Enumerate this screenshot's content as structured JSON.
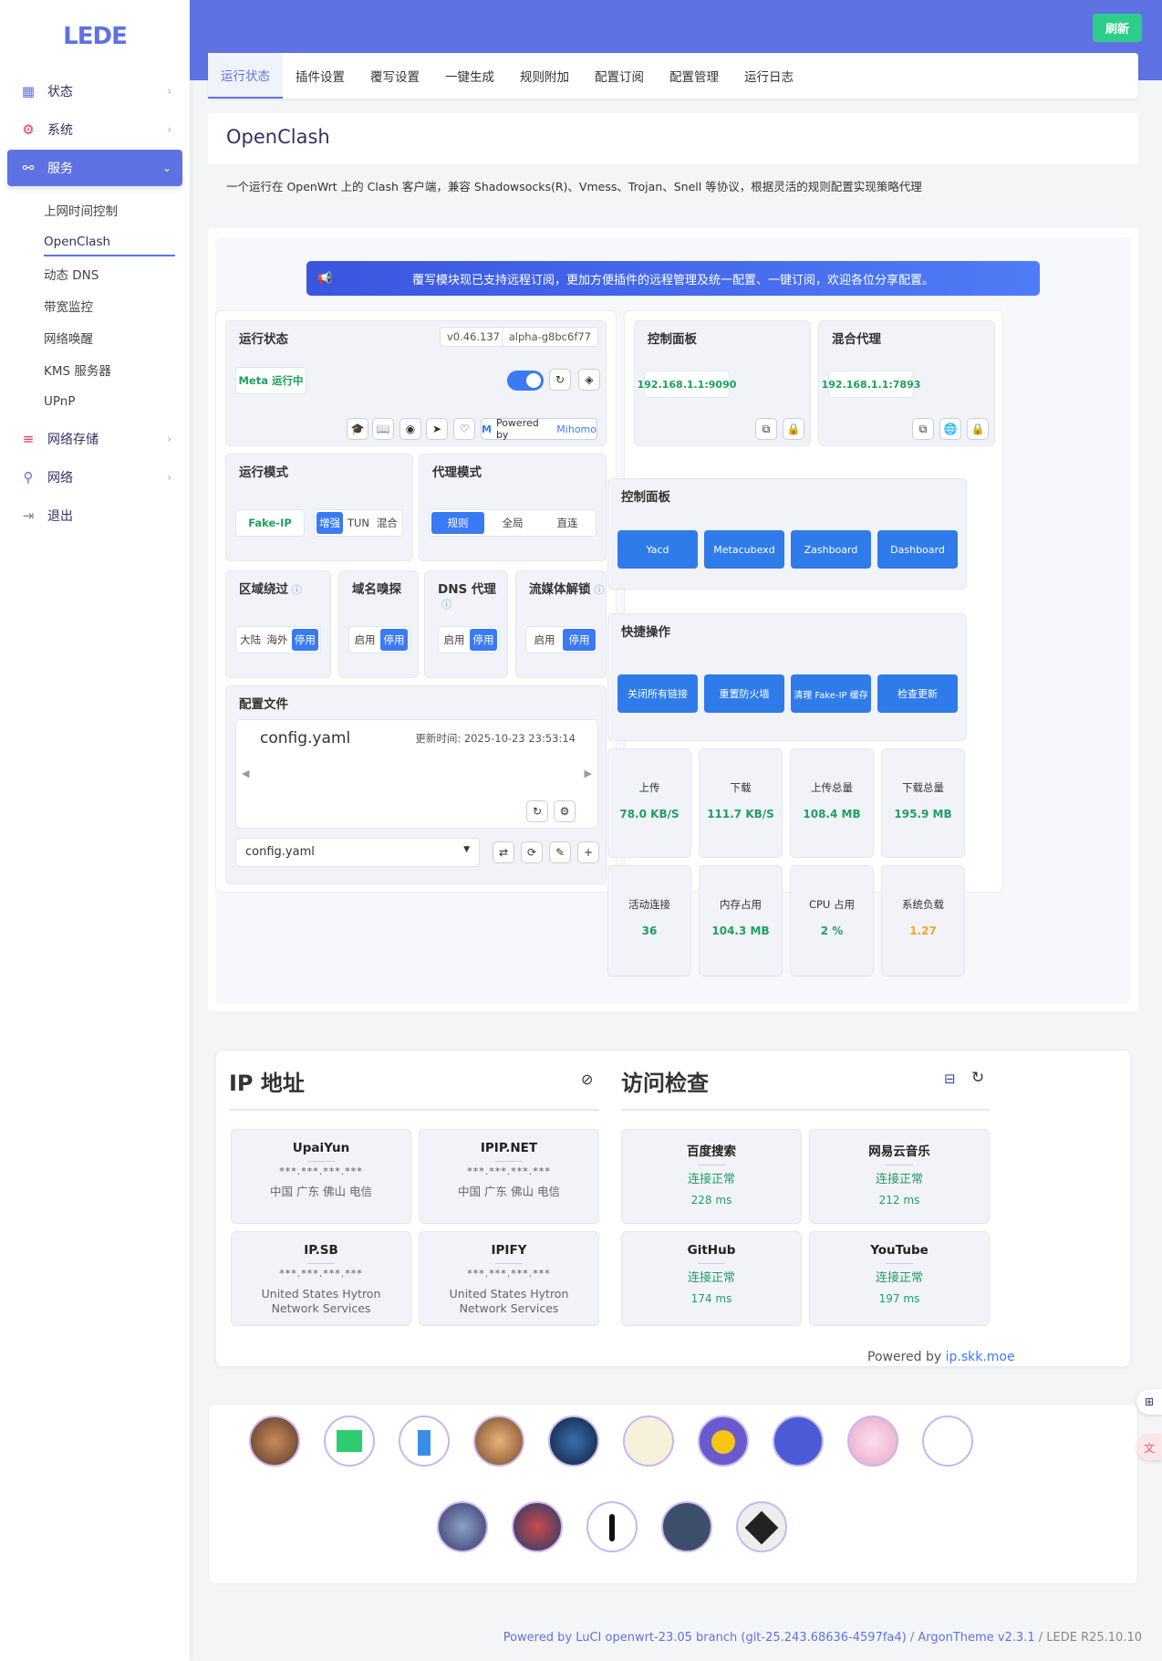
{
  "sidebar": {
    "logo": "LEDE",
    "items": [
      {
        "label": "状态",
        "icon": "dashboard-icon"
      },
      {
        "label": "系统",
        "icon": "gear-icon"
      },
      {
        "label": "服务",
        "icon": "services-icon"
      },
      {
        "label": "网络存储",
        "icon": "database-icon"
      },
      {
        "label": "网络",
        "icon": "network-icon"
      },
      {
        "label": "退出",
        "icon": "logout-icon"
      }
    ],
    "sub": [
      "上网时间控制",
      "OpenClash",
      "动态 DNS",
      "带宽监控",
      "网络唤醒",
      "KMS 服务器",
      "UPnP"
    ]
  },
  "header": {
    "refresh": "刷新"
  },
  "tabs": [
    "运行状态",
    "插件设置",
    "覆写设置",
    "一键生成",
    "规则附加",
    "配置订阅",
    "配置管理",
    "运行日志"
  ],
  "page": {
    "title": "OpenClash",
    "desc": "一个运行在 OpenWrt 上的 Clash 客户端，兼容 Shadowsocks(R)、Vmess、Trojan、Snell 等协议，根据灵活的规则配置实现策略代理",
    "banner": "覆写模块现已支持远程订阅，更加方便插件的远程管理及统一配置、一键订阅，欢迎各位分享配置。"
  },
  "status": {
    "title": "运行状态",
    "version": "v0.46.137",
    "core": "alpha-g8bc6f77",
    "state": "Meta 运行中",
    "powered_by": "Powered by",
    "mihomo": "Mihomo"
  },
  "control": {
    "title": "控制面板",
    "addr": "192.168.1.1:9090"
  },
  "mixed": {
    "title": "混合代理",
    "addr": "192.168.1.1:7893"
  },
  "run_mode": {
    "title": "运行模式",
    "fake": "Fake-IP",
    "opts": [
      "增强",
      "TUN",
      "混合"
    ]
  },
  "proxy_mode": {
    "title": "代理模式",
    "opts": [
      "规则",
      "全局",
      "直连"
    ]
  },
  "dashboards": {
    "title": "控制面板",
    "buttons": [
      "Yacd",
      "Metacubexd",
      "Zashboard",
      "Dashboard"
    ]
  },
  "bypass": {
    "title": "区域绕过",
    "opts": [
      "大陆",
      "海外",
      "停用"
    ]
  },
  "sniff": {
    "title": "域名嗅探",
    "opts": [
      "启用",
      "停用"
    ]
  },
  "dns": {
    "title": "DNS 代理",
    "opts": [
      "启用",
      "停用"
    ]
  },
  "media": {
    "title": "流媒体解锁",
    "opts": [
      "启用",
      "停用"
    ]
  },
  "quick": {
    "title": "快捷操作",
    "buttons": [
      "关闭所有链接",
      "重置防火墙",
      "清理 Fake-IP 缓存",
      "检查更新"
    ]
  },
  "config": {
    "title": "配置文件",
    "file": "config.yaml",
    "updated": "更新时间: 2025-10-23 23:53:14",
    "select": "config.yaml"
  },
  "stats": [
    {
      "label": "上传",
      "value": "78.0 KB/S"
    },
    {
      "label": "下载",
      "value": "111.7 KB/S"
    },
    {
      "label": "上传总量",
      "value": "108.4 MB"
    },
    {
      "label": "下载总量",
      "value": "195.9 MB"
    },
    {
      "label": "活动连接",
      "value": "36"
    },
    {
      "label": "内存占用",
      "value": "104.3 MB"
    },
    {
      "label": "CPU 占用",
      "value": "2 %"
    },
    {
      "label": "系统负载",
      "value": "1.27"
    }
  ],
  "ip": {
    "title": "IP 地址",
    "cards": [
      {
        "name": "UpaiYun",
        "mask": "***.***.***.***",
        "loc": "中国 广东 佛山 电信"
      },
      {
        "name": "IPIP.NET",
        "mask": "***.***.***.***",
        "loc": "中国 广东 佛山 电信"
      },
      {
        "name": "IP.SB",
        "mask": "***.***.***.***",
        "loc": "United States Hytron Network Services"
      },
      {
        "name": "IPIFY",
        "mask": "***.***.***.***",
        "loc": "United States Hytron Network Services"
      }
    ]
  },
  "access": {
    "title": "访问检查",
    "cards": [
      {
        "name": "百度搜索",
        "status": "连接正常",
        "ms": "228 ms"
      },
      {
        "name": "网易云音乐",
        "status": "连接正常",
        "ms": "212 ms"
      },
      {
        "name": "GitHub",
        "status": "连接正常",
        "ms": "174 ms"
      },
      {
        "name": "YouTube",
        "status": "连接正常",
        "ms": "197 ms"
      }
    ],
    "powered": "Powered by",
    "powered_link": "ip.skk.moe"
  },
  "footer": {
    "luci": "Powered by LuCI openwrt-23.05 branch (git-25.243.68636-4597fa4)",
    "sep1": " / ",
    "argon": "ArgonTheme v2.3.1",
    "sep2": " / ",
    "lede": "LEDE R25.10.10"
  },
  "colors": {
    "primary": "#5e72e4",
    "blue": "#2f7bea",
    "green": "#1f9f60",
    "orange": "#f5a623",
    "refresh": "#2dce89"
  }
}
